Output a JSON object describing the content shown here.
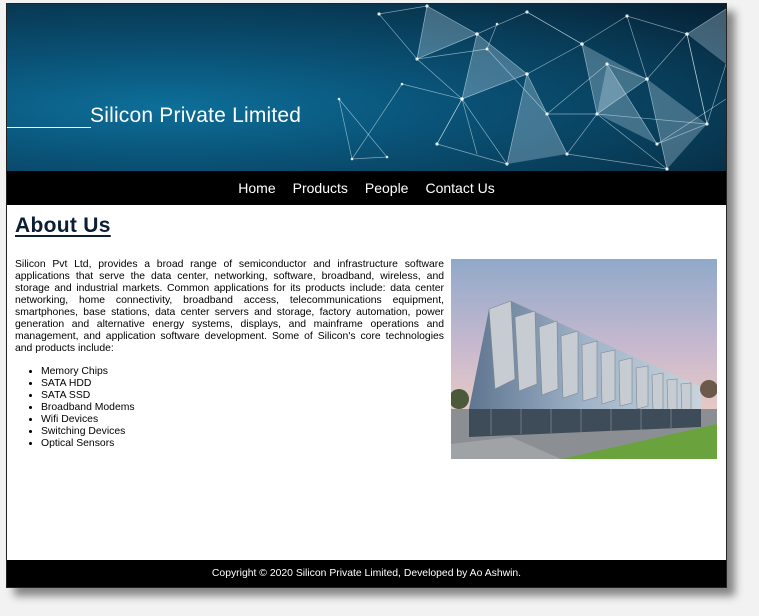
{
  "header": {
    "title": "Silicon Private Limited"
  },
  "nav": {
    "items": [
      "Home",
      "Products",
      "People",
      "Contact Us"
    ]
  },
  "about": {
    "heading": "About Us",
    "paragraph": "Silicon Pvt Ltd, provides a broad range of semiconductor and infrastructure software applications that serve the data center, networking, software, broadband, wireless, and storage and industrial markets. Common applications for its products include: data center networking, home connectivity, broadband access, telecommunications equipment, smartphones, base stations, data center servers and storage, factory automation, power generation and alternative energy systems, displays, and mainframe operations and management, and application software development. Some of Silicon's core technologies and products include:",
    "products": [
      "Memory Chips",
      "SATA HDD",
      "SATA SSD",
      "Broadband Modems",
      "Wifi Devices",
      "Switching Devices",
      "Optical Sensors"
    ]
  },
  "footer": {
    "copyright": "Copyright © 2020 Silicon Private Limited, Developed by Ao Ashwin."
  },
  "colors": {
    "banner_dark": "#061f33",
    "banner_light": "#0d6f99",
    "nav_bg": "#000000",
    "heading": "#0b1e35"
  }
}
